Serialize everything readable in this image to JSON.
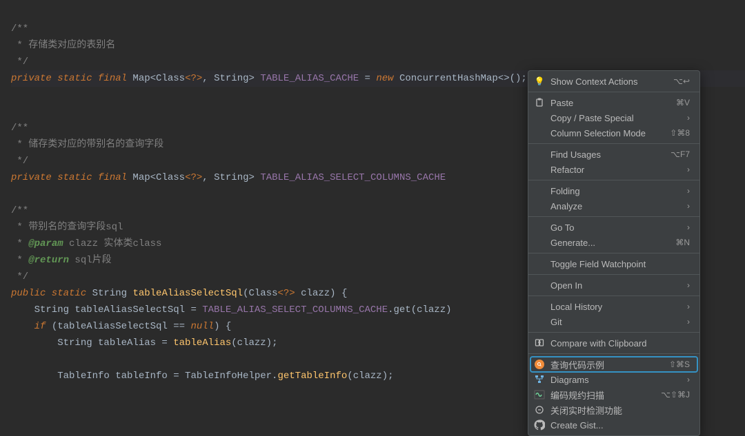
{
  "code": {
    "c1a": "/**",
    "c1b": " * 存储类对应的表别名",
    "c1c": " */",
    "l1_kw": "private static final",
    "l1_type": " Map",
    "l1_gen_open": "<",
    "l1_class": "Class",
    "l1_q": "<?>",
    "l1_sep": ", ",
    "l1_str": "String",
    "l1_gen_close": "> ",
    "l1_const": "TABLE_ALIAS_CACHE",
    "l1_eq": " = ",
    "l1_new": "new",
    "l1_impl": " ConcurrentHashMap<>();",
    "blank": "",
    "c2a": "/**",
    "c2b": " * 储存类对应的带别名的查询字段",
    "c2c": " */",
    "l2_kw": "private static final",
    "l2_type": " Map",
    "l2_gen_open": "<",
    "l2_class": "Class",
    "l2_q": "<?>",
    "l2_sep": ", ",
    "l2_str": "String",
    "l2_gen_close": "> ",
    "l2_const": "TABLE_ALIAS_SELECT_COLUMNS_CACHE",
    "l2_tail": "                          );",
    "c3a": "/**",
    "c3b": " * 带别名的查询字段sql",
    "c3c_star": " * ",
    "c3c_tag": "@param",
    "c3c_rest": " clazz 实体类class",
    "c3d_tag": "@return",
    "c3d_rest": " sql片段",
    "c3e": " */",
    "m_kw": "public static",
    "m_ret": " String ",
    "m_name": "tableAliasSelectSql",
    "m_sig_open": "(",
    "m_sig_type": "Class",
    "m_sig_q": "<?>",
    "m_sig_param": " clazz",
    "m_sig_close": ") {",
    "b1_pre": "    String tableAliasSelectSql = ",
    "b1_const": "TABLE_ALIAS_SELECT_COLUMNS_CACHE",
    "b1_get": ".get(clazz)",
    "b2_pre": "    ",
    "b2_if": "if",
    "b2_cond": " (tableAliasSelectSql == ",
    "b2_null": "null",
    "b2_brace": ") {",
    "b3_pre": "        String tableAlias = ",
    "b3_fn": "tableAlias",
    "b3_args": "(clazz);",
    "b4_pre": "        TableInfo tableInfo = TableInfoHelper.",
    "b4_fn": "getTableInfo",
    "b4_args": "(clazz);"
  },
  "menu": {
    "context": {
      "label": "Show Context Actions",
      "shortcut": "⌥↩"
    },
    "paste": {
      "label": "Paste",
      "shortcut": "⌘V"
    },
    "copypaste": {
      "label": "Copy / Paste Special"
    },
    "colsel": {
      "label": "Column Selection Mode",
      "shortcut": "⇧⌘8"
    },
    "findusages": {
      "label": "Find Usages",
      "shortcut": "⌥F7"
    },
    "refactor": {
      "label": "Refactor"
    },
    "folding": {
      "label": "Folding"
    },
    "analyze": {
      "label": "Analyze"
    },
    "goto": {
      "label": "Go To"
    },
    "generate": {
      "label": "Generate...",
      "shortcut": "⌘N"
    },
    "toggle": {
      "label": "Toggle Field Watchpoint"
    },
    "openin": {
      "label": "Open In"
    },
    "localhist": {
      "label": "Local History"
    },
    "git": {
      "label": "Git"
    },
    "compare": {
      "label": "Compare with Clipboard"
    },
    "queryexample": {
      "label": "查询代码示例",
      "shortcut": "⇧⌘S"
    },
    "diagrams": {
      "label": "Diagrams"
    },
    "codescan": {
      "label": "编码规约扫描",
      "shortcut": "⌥⇧⌘J"
    },
    "closecheck": {
      "label": "关闭实时检测功能"
    },
    "gist": {
      "label": "Create Gist..."
    }
  }
}
